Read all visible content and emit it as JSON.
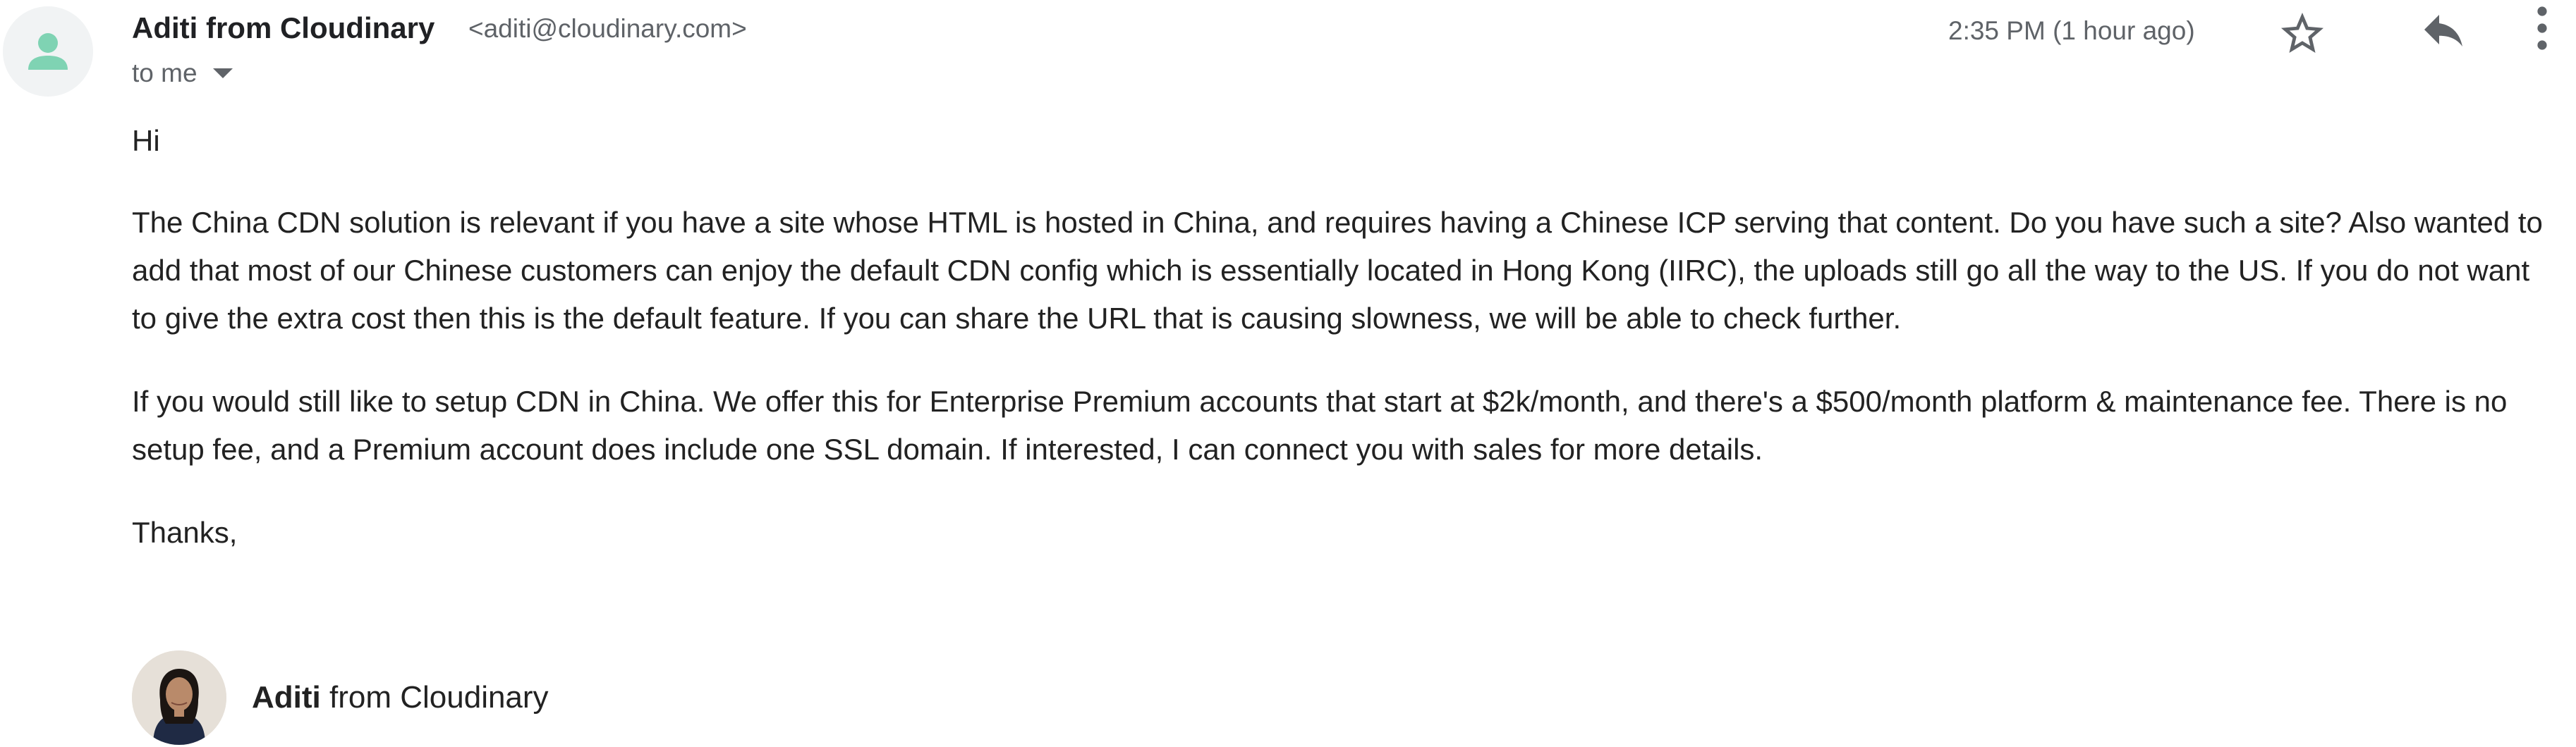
{
  "header": {
    "sender_name": "Aditi from Cloudinary",
    "sender_email": "<aditi@cloudinary.com>",
    "recipient": "to me",
    "timestamp": "2:35 PM (1 hour ago)",
    "icons": {
      "avatar": "person-icon",
      "star": "star-outline-icon",
      "reply": "reply-icon",
      "more": "more-vert-icon"
    }
  },
  "body": {
    "greeting": "Hi",
    "paragraph1": "The China CDN solution is relevant if you have a site whose HTML is hosted in China, and requires having a Chinese ICP serving that content. Do you have such a site? Also wanted to add that most of our Chinese customers can enjoy the default CDN config which is essentially located in Hong Kong (IIRC), the uploads still go all the way to the US. If you do not want to give the extra cost then this is the default feature. If you can share the URL that is causing slowness, we will be able to check further.",
    "paragraph2": "If you would still like to setup CDN in China. We offer this for Enterprise Premium accounts that start at $2k/month, and there's a $500/month platform & maintenance fee. There is no setup fee, and a Premium account does include one SSL domain. If interested, I can connect you with sales for more details.",
    "closing": "Thanks,"
  },
  "signature": {
    "name": "Aditi",
    "company": "from Cloudinary"
  },
  "colors": {
    "avatar_bg": "#f1f3f4",
    "avatar_person": "#7fd3b3",
    "icon_gray": "#5f6368",
    "text": "#222222"
  }
}
